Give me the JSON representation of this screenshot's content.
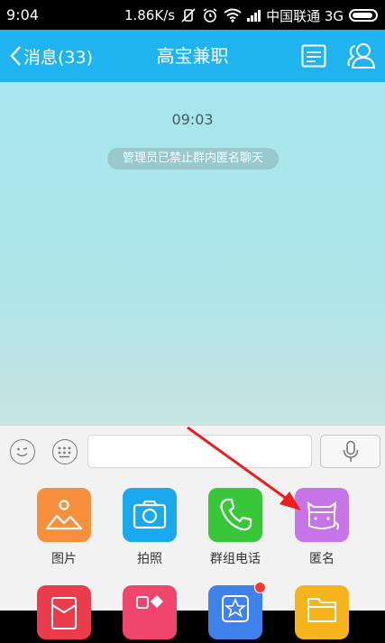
{
  "status_bar": {
    "time": "9:04",
    "speed": "1.86K/s",
    "carrier": "中国联通 3G"
  },
  "header": {
    "back_label": "消息(33)",
    "title": "高宝兼职"
  },
  "chat": {
    "timestamp": "09:03",
    "system_notice": "管理员已禁止群内匿名聊天"
  },
  "input": {
    "placeholder": ""
  },
  "panel": {
    "items": [
      {
        "label": "图片",
        "icon": "picture-icon",
        "color": "#f7903d"
      },
      {
        "label": "拍照",
        "icon": "camera-icon",
        "color": "#1aa8ee"
      },
      {
        "label": "群组电话",
        "icon": "phone-icon",
        "color": "#37c739"
      },
      {
        "label": "匿名",
        "icon": "anonymous-mask-icon",
        "color": "#c674e6"
      }
    ],
    "row2": [
      {
        "icon": "red-packet-icon",
        "color": "#ec3b4a"
      },
      {
        "icon": "shapes-icon",
        "color": "#f0456d"
      },
      {
        "icon": "star-badge-icon",
        "color": "#3f82ec",
        "badge": true
      },
      {
        "icon": "folder-icon",
        "color": "#f5b41c"
      }
    ]
  },
  "colors": {
    "header": "#1fb4f0",
    "annotation_arrow": "#ee1c1c"
  }
}
